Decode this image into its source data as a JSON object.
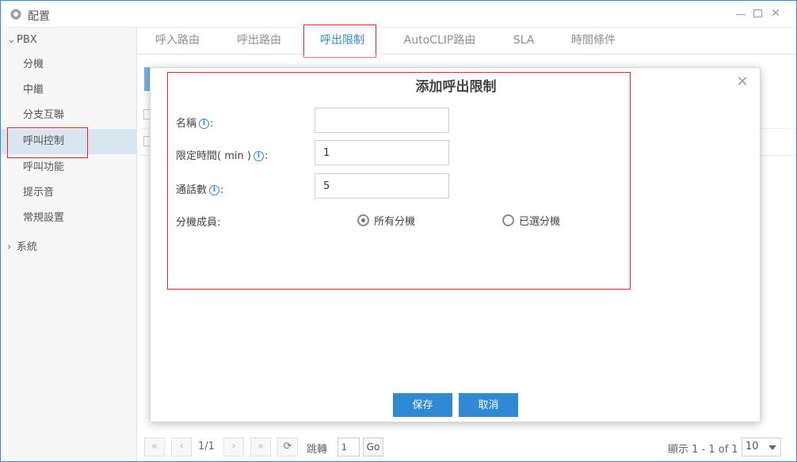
{
  "window": {
    "title": "配置",
    "icons": {
      "app": "gear-icon",
      "minimize": "minimize-icon",
      "maximize": "maximize-icon",
      "close": "close-icon"
    }
  },
  "sidebar": {
    "group_pbx": "PBX",
    "items": [
      {
        "label": "分機"
      },
      {
        "label": "中繼"
      },
      {
        "label": "分支互聯"
      },
      {
        "label": "呼叫控制",
        "active": true
      },
      {
        "label": "呼叫功能"
      },
      {
        "label": "提示音"
      },
      {
        "label": "常規設置"
      }
    ],
    "group_system": "系統"
  },
  "tabs": [
    {
      "label": "呼入路由"
    },
    {
      "label": "呼出路由"
    },
    {
      "label": "呼出限制",
      "active": true
    },
    {
      "label": "AutoCLIP路由"
    },
    {
      "label": "SLA"
    },
    {
      "label": "時間條件"
    }
  ],
  "modal": {
    "title": "添加呼出限制",
    "fields": {
      "name": {
        "label": "名稱",
        "value": ""
      },
      "limit_time": {
        "label": "限定時間( min )",
        "value": "1"
      },
      "call_count": {
        "label": "通話數",
        "value": "5"
      },
      "members": {
        "label": "分機成員"
      }
    },
    "radios": [
      {
        "label": "所有分機",
        "checked": true
      },
      {
        "label": "已選分機",
        "checked": false
      }
    ],
    "save_label": "保存",
    "cancel_label": "取消"
  },
  "pager": {
    "page_text": "1/1",
    "jump_label": "跳轉",
    "jump_value": "1",
    "go_label": "Go",
    "summary": "顯示 1 - 1 of 1",
    "page_size": "10"
  },
  "colors": {
    "accent": "#2f89d4",
    "highlight": "#e0272c",
    "active_row": "#d9e6f2"
  }
}
